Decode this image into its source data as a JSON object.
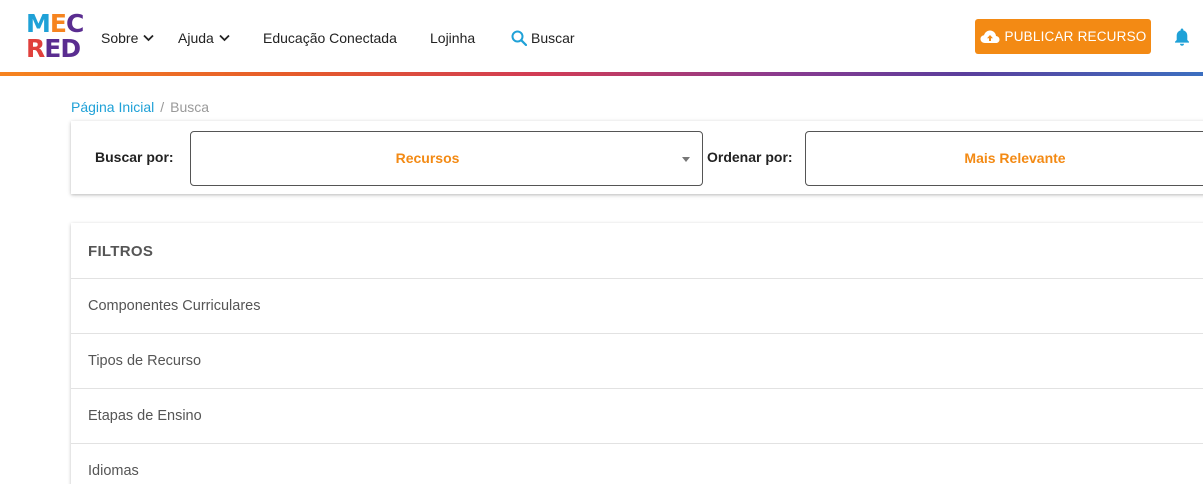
{
  "brand": {
    "logo_line1": [
      "M",
      "E",
      "C"
    ],
    "logo_line2": [
      "R",
      "E",
      "D"
    ],
    "colors": {
      "blue": "#1fa1d7",
      "orange": "#f6841f",
      "purple": "#5a2d90",
      "red": "#e0403c"
    }
  },
  "nav": {
    "sobre": "Sobre",
    "ajuda": "Ajuda",
    "educacao": "Educação Conectada",
    "lojinha": "Lojinha",
    "buscar": "Buscar",
    "publish_label": "PUBLICAR RECURSO",
    "icons": [
      "chevron-down-icon",
      "search-icon",
      "cloud-upload-icon",
      "bell-icon"
    ]
  },
  "breadcrumb": {
    "home": "Página Inicial",
    "separator": "/",
    "current": "Busca"
  },
  "search": {
    "search_by_label": "Buscar por:",
    "search_by_value": "Recursos",
    "order_by_label": "Ordenar por:",
    "order_by_value": "Mais Relevante"
  },
  "filters": {
    "title": "FILTROS",
    "items": [
      "Componentes Curriculares",
      "Tipos de Recurso",
      "Etapas de Ensino",
      "Idiomas"
    ]
  },
  "accent_color": "#f38a14"
}
